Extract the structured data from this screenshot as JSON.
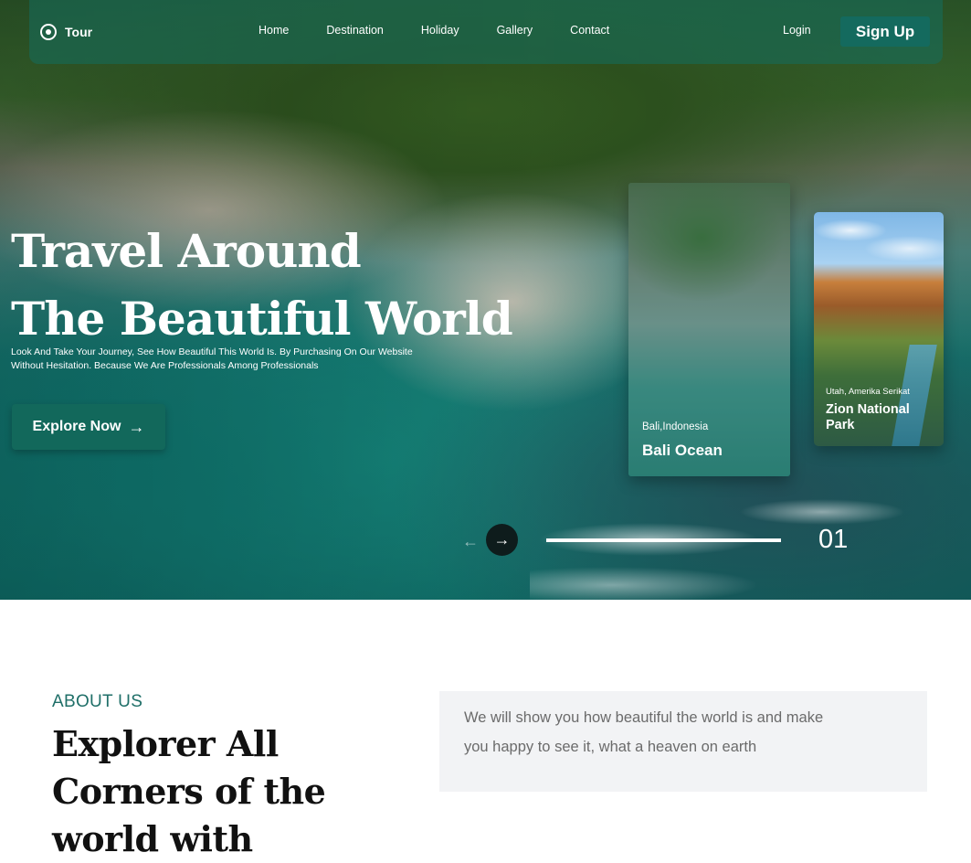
{
  "nav": {
    "logo_text": "Tour",
    "links": [
      "Home",
      "Destination",
      "Holiday",
      "Gallery",
      "Contact"
    ],
    "login_label": "Login",
    "signup_label": "Sign Up"
  },
  "hero": {
    "title_line1": "Travel Around",
    "title_line2": "The Beautiful World",
    "description": "Look And Take Your Journey, See How Beautiful This World Is. By Purchasing On Our Website Without Hesitation. Because We Are Professionals Among Professionals",
    "cta_label": "Explore Now",
    "cta_icon": "arrow-right-icon"
  },
  "cards": [
    {
      "subtitle": "Bali,Indonesia",
      "title": "Bali Ocean"
    },
    {
      "subtitle": "Utah, Amerika Serikat",
      "title": "Zion National Park"
    }
  ],
  "slider": {
    "current": "01",
    "progress": 1,
    "prev_icon": "arrow-left-icon",
    "next_icon": "arrow-right-icon"
  },
  "about": {
    "label": "ABOUT US",
    "title": "Explorer All Corners of the world with",
    "description": "We will show you how beautiful the world is and make you happy to see it, what a heaven on earth"
  },
  "colors": {
    "accent": "#146a5e",
    "about_label": "#1f6f68",
    "dark_button": "#0e1c1c",
    "about_box_bg": "#f2f3f5"
  }
}
